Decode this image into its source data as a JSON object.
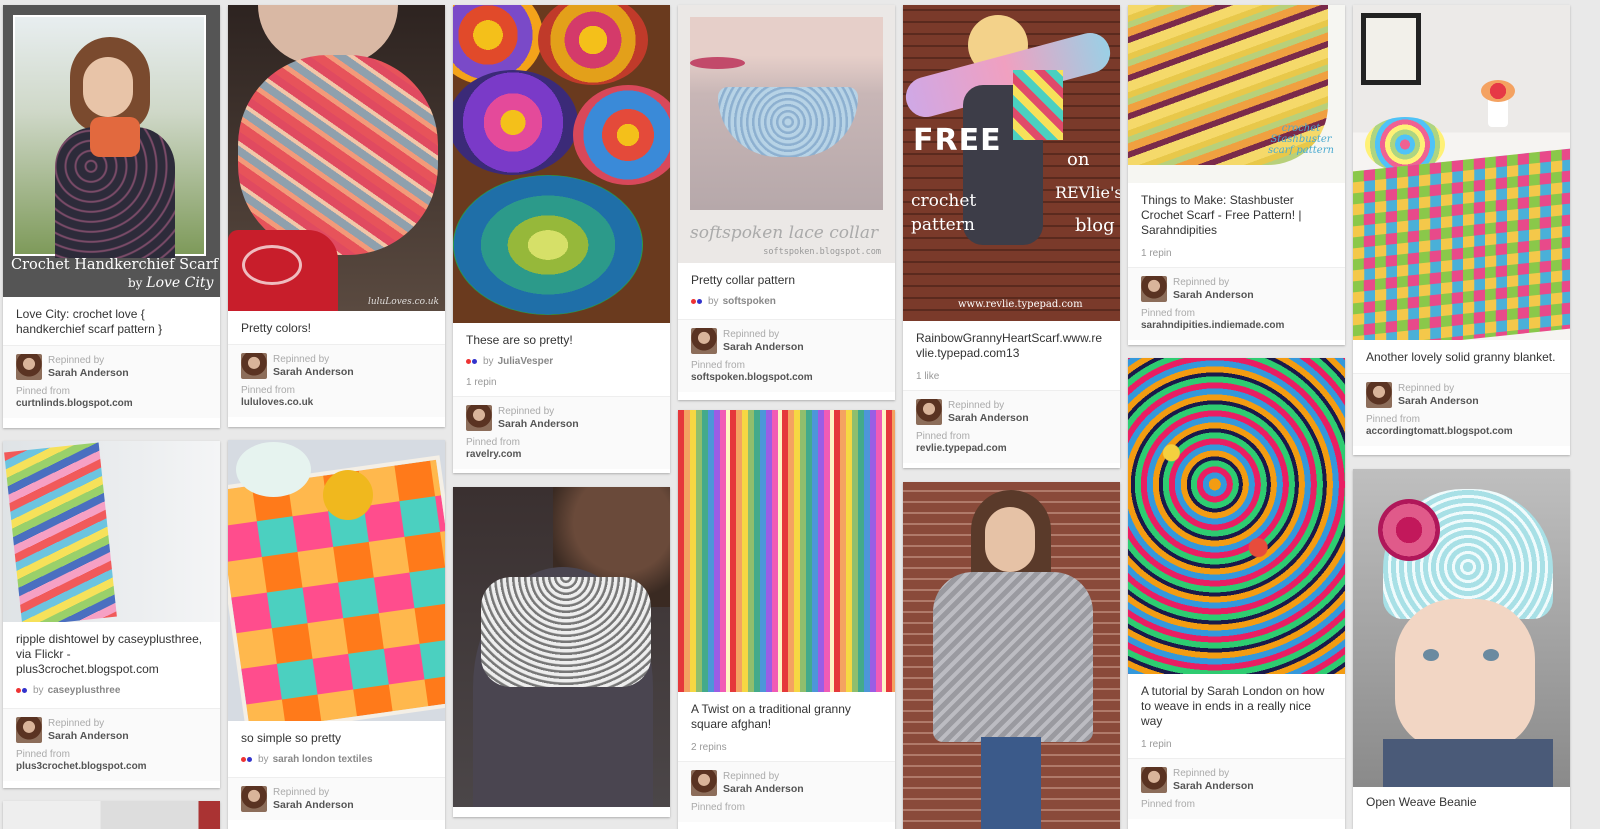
{
  "pins": [
    {
      "description": "Love City: crochet love { handkerchief scarf pattern }",
      "overlay_title": "Crochet Handkerchief Scarf",
      "overlay_by": "by",
      "overlay_brand": "Love City",
      "repinned_label": "Repinned by",
      "repinned_by": "Sarah Anderson",
      "pinned_from_label": "Pinned from",
      "source": "curtnlinds.blogspot.com"
    },
    {
      "description": "Pretty colors!",
      "watermark": "luluLoves.co.uk",
      "repinned_label": "Repinned by",
      "repinned_by": "Sarah Anderson",
      "pinned_from_label": "Pinned from",
      "source": "lululoves.co.uk"
    },
    {
      "description": "These are so pretty!",
      "via_prefix": "by",
      "via_user": "JuliaVesper",
      "stats": "1 repin",
      "repinned_label": "Repinned by",
      "repinned_by": "Sarah Anderson",
      "pinned_from_label": "Pinned from",
      "source": "ravelry.com"
    },
    {
      "description": "Pretty collar pattern",
      "overlay_title": "softspoken lace collar",
      "overlay_sub": "softspoken.blogspot.com",
      "via_prefix": "by",
      "via_user": "softspoken",
      "repinned_label": "Repinned by",
      "repinned_by": "Sarah Anderson",
      "pinned_from_label": "Pinned from",
      "source": "softspoken.blogspot.com"
    },
    {
      "description": "RainbowGrannyHeartScarf.www.revlie.typepad.com13",
      "overlay_free": "FREE",
      "overlay_crochet": "crochet",
      "overlay_pattern": "pattern",
      "overlay_on": "on",
      "overlay_revlies": "REVlie's",
      "overlay_blog": "blog",
      "overlay_url": "www.revlie.typepad.com",
      "stats": "1 like",
      "repinned_label": "Repinned by",
      "repinned_by": "Sarah Anderson",
      "pinned_from_label": "Pinned from",
      "source": "revlie.typepad.com"
    },
    {
      "description": "Things to Make: Stashbuster Crochet Scarf - Free Pattern! | Sarahndipities",
      "overlay_text": "crochet Stashbuster scarf pattern",
      "stats": "1 repin",
      "repinned_label": "Repinned by",
      "repinned_by": "Sarah Anderson",
      "pinned_from_label": "Pinned from",
      "source": "sarahndipities.indiemade.com"
    },
    {
      "description": "Another lovely solid granny blanket.",
      "repinned_label": "Repinned by",
      "repinned_by": "Sarah Anderson",
      "pinned_from_label": "Pinned from",
      "source": "accordingtomatt.blogspot.com"
    },
    {
      "description": "ripple dishtowel by caseyplusthree, via Flickr - plus3crochet.blogspot.com",
      "via_prefix": "by",
      "via_user": "caseyplusthree",
      "repinned_label": "Repinned by",
      "repinned_by": "Sarah Anderson",
      "pinned_from_label": "Pinned from",
      "source": "plus3crochet.blogspot.com"
    },
    {
      "description": "so simple so pretty",
      "via_prefix": "by",
      "via_user": "sarah london textiles",
      "repinned_label": "Repinned by",
      "repinned_by": "Sarah Anderson"
    },
    {
      "description": "A Twist on a traditional granny square afghan!",
      "stats": "2 repins",
      "repinned_label": "Repinned by",
      "repinned_by": "Sarah Anderson",
      "pinned_from_label": "Pinned from"
    },
    {
      "description": "A tutorial by Sarah London on how to weave in ends in a really nice way",
      "stats": "1 repin",
      "repinned_label": "Repinned by",
      "repinned_by": "Sarah Anderson",
      "pinned_from_label": "Pinned from"
    },
    {
      "description": "Open Weave Beanie"
    },
    {},
    {}
  ],
  "colors": {
    "background": "#e9e9e9",
    "card": "#ffffff",
    "text": "#333333",
    "muted": "#999999"
  },
  "icons": [
    "pinner-dots-icon",
    "avatar"
  ]
}
